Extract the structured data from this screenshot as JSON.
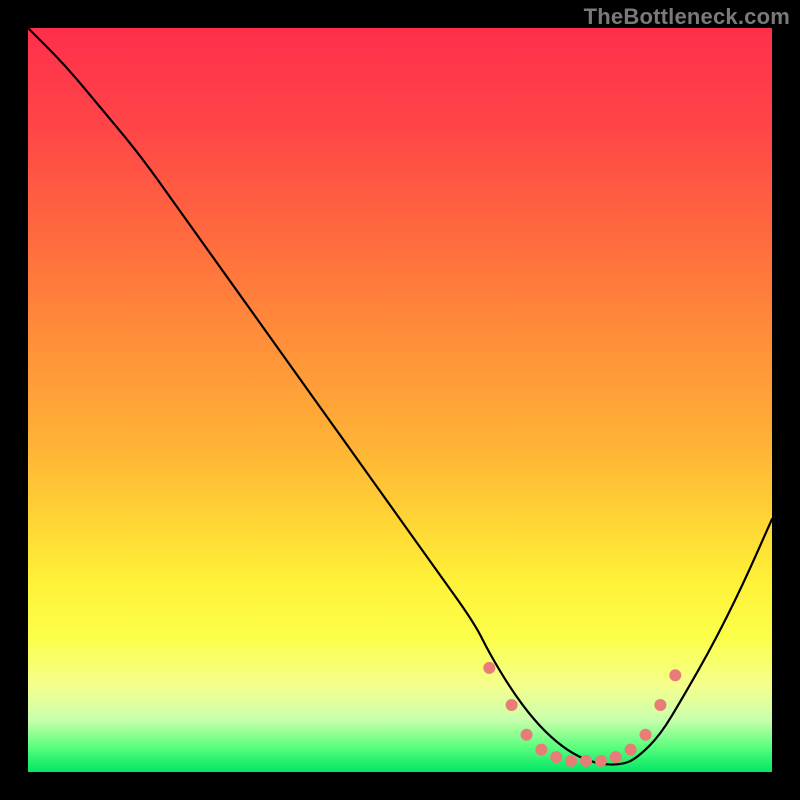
{
  "watermark": "TheBottleneck.com",
  "chart_data": {
    "type": "line",
    "title": "",
    "xlabel": "",
    "ylabel": "",
    "xlim": [
      0,
      100
    ],
    "ylim": [
      0,
      100
    ],
    "series": [
      {
        "name": "curve",
        "x": [
          0,
          5,
          10,
          15,
          20,
          25,
          30,
          35,
          40,
          45,
          50,
          55,
          60,
          62,
          65,
          68,
          71,
          74,
          77,
          80,
          82,
          85,
          88,
          92,
          96,
          100
        ],
        "y": [
          100,
          95,
          89,
          83,
          76,
          69,
          62,
          55,
          48,
          41,
          34,
          27,
          20,
          16,
          11,
          7,
          4,
          2,
          1,
          1,
          2,
          5,
          10,
          17,
          25,
          34
        ]
      }
    ],
    "gradient_stops": [
      {
        "offset": 0.0,
        "color": "#ff2e4c"
      },
      {
        "offset": 0.14,
        "color": "#ff4747"
      },
      {
        "offset": 0.28,
        "color": "#ff6a3e"
      },
      {
        "offset": 0.42,
        "color": "#ff8f39"
      },
      {
        "offset": 0.56,
        "color": "#ffb236"
      },
      {
        "offset": 0.66,
        "color": "#ffd435"
      },
      {
        "offset": 0.74,
        "color": "#fff037"
      },
      {
        "offset": 0.82,
        "color": "#fbff4a"
      },
      {
        "offset": 0.885,
        "color": "#f4ff8e"
      },
      {
        "offset": 0.93,
        "color": "#c8ffac"
      },
      {
        "offset": 0.965,
        "color": "#5eff7e"
      },
      {
        "offset": 1.0,
        "color": "#00e765"
      }
    ],
    "dots": {
      "color": "#e87d78",
      "radius": 6,
      "points": [
        {
          "x": 62,
          "y": 14
        },
        {
          "x": 65,
          "y": 9
        },
        {
          "x": 67,
          "y": 5
        },
        {
          "x": 69,
          "y": 3
        },
        {
          "x": 71,
          "y": 2
        },
        {
          "x": 73,
          "y": 1.5
        },
        {
          "x": 75,
          "y": 1.5
        },
        {
          "x": 77,
          "y": 1.5
        },
        {
          "x": 79,
          "y": 2
        },
        {
          "x": 81,
          "y": 3
        },
        {
          "x": 83,
          "y": 5
        },
        {
          "x": 85,
          "y": 9
        },
        {
          "x": 87,
          "y": 13
        }
      ]
    }
  }
}
